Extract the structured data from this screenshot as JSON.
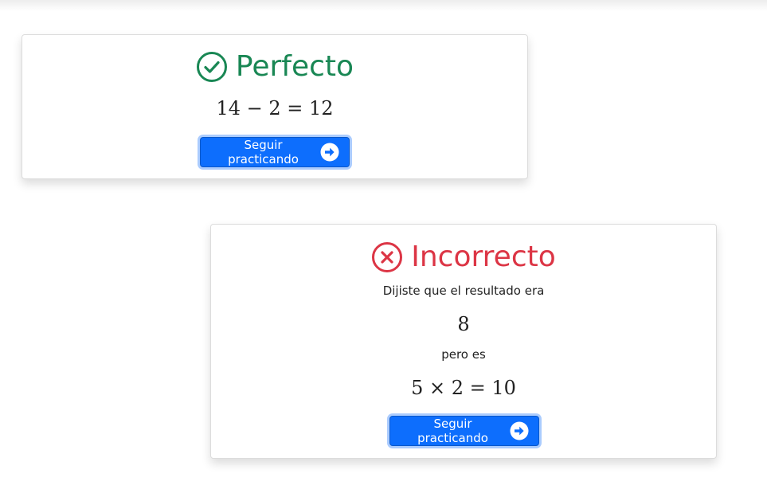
{
  "colors": {
    "success": "#198754",
    "error": "#dc3545",
    "button": "#0d6efd",
    "text": "#222222"
  },
  "success_card": {
    "icon": "check-circle-icon",
    "title": "Perfecto",
    "equation": "14 − 2 = 12",
    "button_label": "Seguir practicando",
    "button_icon": "arrow-right-circle-icon"
  },
  "error_card": {
    "icon": "x-circle-icon",
    "title": "Incorrecto",
    "said_text": "Dijiste que el resultado era",
    "user_answer": "8",
    "but_text": "pero es",
    "equation": "5 × 2 = 10",
    "button_label": "Seguir practicando",
    "button_icon": "arrow-right-circle-icon"
  }
}
